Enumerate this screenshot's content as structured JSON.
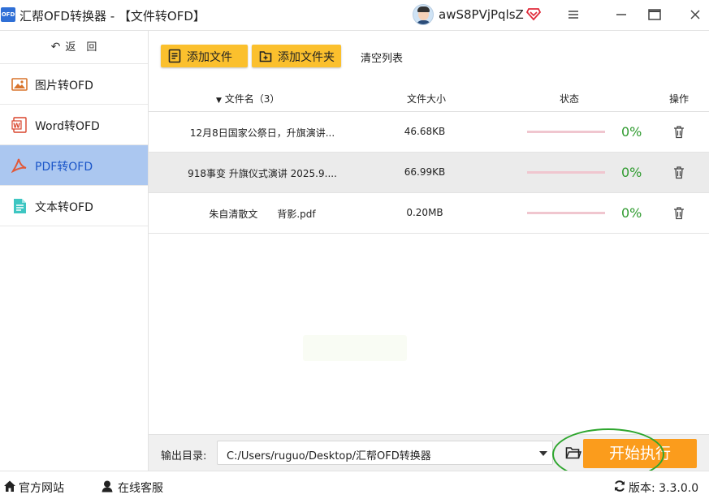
{
  "window": {
    "logo_text": "OFD",
    "title": "汇帮OFD转换器 - 【文件转OFD】",
    "username": "awS8PVjPqlsZ"
  },
  "sidebar": {
    "back_label": "返　回",
    "items": [
      {
        "label": "图片转OFD",
        "icon": "image-icon",
        "active": false
      },
      {
        "label": "Word转OFD",
        "icon": "word-icon",
        "active": false
      },
      {
        "label": "PDF转OFD",
        "icon": "pdf-icon",
        "active": true
      },
      {
        "label": "文本转OFD",
        "icon": "text-file-icon",
        "active": false
      }
    ]
  },
  "toolbar": {
    "add_file_label": "添加文件",
    "add_folder_label": "添加文件夹",
    "clear_label": "清空列表"
  },
  "table": {
    "columns": {
      "name": "文件名（3）",
      "size": "文件大小",
      "status": "状态",
      "operation": "操作"
    },
    "rows": [
      {
        "name": "12月8日国家公祭日，升旗演讲...",
        "size": "46.68KB",
        "progress": 0,
        "percent": "0%",
        "selected": false
      },
      {
        "name": "918事变 升旗仪式演讲 2025.9....",
        "size": "66.99KB",
        "progress": 0,
        "percent": "0%",
        "selected": true
      },
      {
        "name": "朱自清散文　　背影.pdf",
        "size": "0.20MB",
        "progress": 0,
        "percent": "0%",
        "selected": false
      }
    ]
  },
  "output": {
    "label": "输出目录:",
    "path": "C:/Users/ruguo/Desktop/汇帮OFD转换器",
    "start_label": "开始执行"
  },
  "statusbar": {
    "website_label": "官方网站",
    "service_label": "在线客服",
    "version_label": "版本:",
    "version_value": "3.3.0.0"
  },
  "colors": {
    "accent_yellow": "#fbc02d",
    "start_orange": "#fb9c1c",
    "active_sidebar": "#abc7f0",
    "percent_green": "#2e9a2e",
    "highlight_green": "#2ea62e"
  }
}
